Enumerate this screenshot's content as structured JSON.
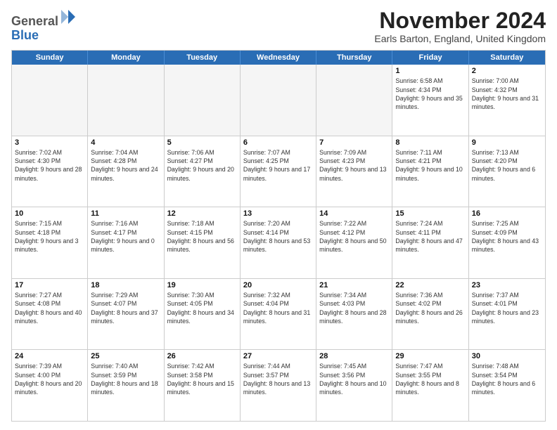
{
  "logo": {
    "general": "General",
    "blue": "Blue"
  },
  "title": "November 2024",
  "location": "Earls Barton, England, United Kingdom",
  "days_of_week": [
    "Sunday",
    "Monday",
    "Tuesday",
    "Wednesday",
    "Thursday",
    "Friday",
    "Saturday"
  ],
  "rows": [
    [
      {
        "day": "",
        "empty": true
      },
      {
        "day": "",
        "empty": true
      },
      {
        "day": "",
        "empty": true
      },
      {
        "day": "",
        "empty": true
      },
      {
        "day": "",
        "empty": true
      },
      {
        "day": "1",
        "sunrise": "Sunrise: 6:58 AM",
        "sunset": "Sunset: 4:34 PM",
        "daylight": "Daylight: 9 hours and 35 minutes."
      },
      {
        "day": "2",
        "sunrise": "Sunrise: 7:00 AM",
        "sunset": "Sunset: 4:32 PM",
        "daylight": "Daylight: 9 hours and 31 minutes."
      }
    ],
    [
      {
        "day": "3",
        "sunrise": "Sunrise: 7:02 AM",
        "sunset": "Sunset: 4:30 PM",
        "daylight": "Daylight: 9 hours and 28 minutes."
      },
      {
        "day": "4",
        "sunrise": "Sunrise: 7:04 AM",
        "sunset": "Sunset: 4:28 PM",
        "daylight": "Daylight: 9 hours and 24 minutes."
      },
      {
        "day": "5",
        "sunrise": "Sunrise: 7:06 AM",
        "sunset": "Sunset: 4:27 PM",
        "daylight": "Daylight: 9 hours and 20 minutes."
      },
      {
        "day": "6",
        "sunrise": "Sunrise: 7:07 AM",
        "sunset": "Sunset: 4:25 PM",
        "daylight": "Daylight: 9 hours and 17 minutes."
      },
      {
        "day": "7",
        "sunrise": "Sunrise: 7:09 AM",
        "sunset": "Sunset: 4:23 PM",
        "daylight": "Daylight: 9 hours and 13 minutes."
      },
      {
        "day": "8",
        "sunrise": "Sunrise: 7:11 AM",
        "sunset": "Sunset: 4:21 PM",
        "daylight": "Daylight: 9 hours and 10 minutes."
      },
      {
        "day": "9",
        "sunrise": "Sunrise: 7:13 AM",
        "sunset": "Sunset: 4:20 PM",
        "daylight": "Daylight: 9 hours and 6 minutes."
      }
    ],
    [
      {
        "day": "10",
        "sunrise": "Sunrise: 7:15 AM",
        "sunset": "Sunset: 4:18 PM",
        "daylight": "Daylight: 9 hours and 3 minutes."
      },
      {
        "day": "11",
        "sunrise": "Sunrise: 7:16 AM",
        "sunset": "Sunset: 4:17 PM",
        "daylight": "Daylight: 9 hours and 0 minutes."
      },
      {
        "day": "12",
        "sunrise": "Sunrise: 7:18 AM",
        "sunset": "Sunset: 4:15 PM",
        "daylight": "Daylight: 8 hours and 56 minutes."
      },
      {
        "day": "13",
        "sunrise": "Sunrise: 7:20 AM",
        "sunset": "Sunset: 4:14 PM",
        "daylight": "Daylight: 8 hours and 53 minutes."
      },
      {
        "day": "14",
        "sunrise": "Sunrise: 7:22 AM",
        "sunset": "Sunset: 4:12 PM",
        "daylight": "Daylight: 8 hours and 50 minutes."
      },
      {
        "day": "15",
        "sunrise": "Sunrise: 7:24 AM",
        "sunset": "Sunset: 4:11 PM",
        "daylight": "Daylight: 8 hours and 47 minutes."
      },
      {
        "day": "16",
        "sunrise": "Sunrise: 7:25 AM",
        "sunset": "Sunset: 4:09 PM",
        "daylight": "Daylight: 8 hours and 43 minutes."
      }
    ],
    [
      {
        "day": "17",
        "sunrise": "Sunrise: 7:27 AM",
        "sunset": "Sunset: 4:08 PM",
        "daylight": "Daylight: 8 hours and 40 minutes."
      },
      {
        "day": "18",
        "sunrise": "Sunrise: 7:29 AM",
        "sunset": "Sunset: 4:07 PM",
        "daylight": "Daylight: 8 hours and 37 minutes."
      },
      {
        "day": "19",
        "sunrise": "Sunrise: 7:30 AM",
        "sunset": "Sunset: 4:05 PM",
        "daylight": "Daylight: 8 hours and 34 minutes."
      },
      {
        "day": "20",
        "sunrise": "Sunrise: 7:32 AM",
        "sunset": "Sunset: 4:04 PM",
        "daylight": "Daylight: 8 hours and 31 minutes."
      },
      {
        "day": "21",
        "sunrise": "Sunrise: 7:34 AM",
        "sunset": "Sunset: 4:03 PM",
        "daylight": "Daylight: 8 hours and 28 minutes."
      },
      {
        "day": "22",
        "sunrise": "Sunrise: 7:36 AM",
        "sunset": "Sunset: 4:02 PM",
        "daylight": "Daylight: 8 hours and 26 minutes."
      },
      {
        "day": "23",
        "sunrise": "Sunrise: 7:37 AM",
        "sunset": "Sunset: 4:01 PM",
        "daylight": "Daylight: 8 hours and 23 minutes."
      }
    ],
    [
      {
        "day": "24",
        "sunrise": "Sunrise: 7:39 AM",
        "sunset": "Sunset: 4:00 PM",
        "daylight": "Daylight: 8 hours and 20 minutes."
      },
      {
        "day": "25",
        "sunrise": "Sunrise: 7:40 AM",
        "sunset": "Sunset: 3:59 PM",
        "daylight": "Daylight: 8 hours and 18 minutes."
      },
      {
        "day": "26",
        "sunrise": "Sunrise: 7:42 AM",
        "sunset": "Sunset: 3:58 PM",
        "daylight": "Daylight: 8 hours and 15 minutes."
      },
      {
        "day": "27",
        "sunrise": "Sunrise: 7:44 AM",
        "sunset": "Sunset: 3:57 PM",
        "daylight": "Daylight: 8 hours and 13 minutes."
      },
      {
        "day": "28",
        "sunrise": "Sunrise: 7:45 AM",
        "sunset": "Sunset: 3:56 PM",
        "daylight": "Daylight: 8 hours and 10 minutes."
      },
      {
        "day": "29",
        "sunrise": "Sunrise: 7:47 AM",
        "sunset": "Sunset: 3:55 PM",
        "daylight": "Daylight: 8 hours and 8 minutes."
      },
      {
        "day": "30",
        "sunrise": "Sunrise: 7:48 AM",
        "sunset": "Sunset: 3:54 PM",
        "daylight": "Daylight: 8 hours and 6 minutes."
      }
    ]
  ]
}
